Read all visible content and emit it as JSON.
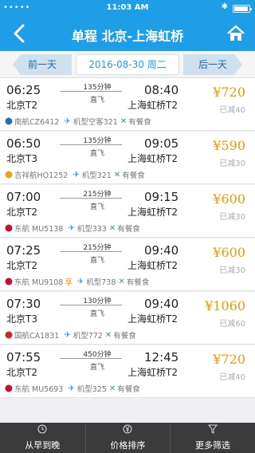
{
  "status": {
    "signal": "•••••",
    "time": "11:03 AM",
    "bluetooth": "✱",
    "battery_level": 0.95
  },
  "nav": {
    "title": "单程 北京-上海虹桥",
    "back_icon": "chevron-left-icon",
    "home_icon": "home-icon"
  },
  "datebar": {
    "prev_label": "前一天",
    "date": "2016-08-30 周二",
    "next_label": "后一天"
  },
  "flights": [
    {
      "dep_time": "06:25",
      "dep_airport": "北京T2",
      "duration": "135分钟",
      "type": "直飞",
      "arr_time": "08:40",
      "arr_airport": "上海虹桥T2",
      "price": "¥720",
      "discount": "已减40",
      "airline": "南航CZ6412",
      "aircraft": "机型空客321",
      "meal": "有餐食",
      "logo_color": "#2a6fb5"
    },
    {
      "dep_time": "06:50",
      "dep_airport": "北京T3",
      "duration": "135分钟",
      "type": "直飞",
      "arr_time": "09:05",
      "arr_airport": "上海虹桥T2",
      "price": "¥590",
      "discount": "已减30",
      "airline": "吉祥航HO1252",
      "aircraft": "机型321",
      "meal": "有餐食",
      "logo_color": "#e8a317"
    },
    {
      "dep_time": "07:00",
      "dep_airport": "北京T2",
      "duration": "215分钟",
      "type": "直飞",
      "arr_time": "09:15",
      "arr_airport": "上海虹桥T2",
      "price": "¥600",
      "discount": "已减30",
      "airline": "东航 MU5138",
      "aircraft": "机型333",
      "meal": "有餐食",
      "logo_color": "#c8102e"
    },
    {
      "dep_time": "07:25",
      "dep_airport": "北京T2",
      "duration": "215分钟",
      "type": "直飞",
      "arr_time": "09:40",
      "arr_airport": "上海虹桥T2",
      "price": "¥600",
      "discount": "已减30",
      "airline": "东航 MU9108",
      "share": "享",
      "aircraft": "机型738",
      "meal": "有餐食",
      "logo_color": "#c8102e"
    },
    {
      "dep_time": "07:30",
      "dep_airport": "北京T3",
      "duration": "130分钟",
      "type": "直飞",
      "arr_time": "09:40",
      "arr_airport": "上海虹桥T2",
      "price": "¥1060",
      "discount": "已减60",
      "airline": "国航CA1831",
      "aircraft": "机型772",
      "meal": "有餐食",
      "logo_color": "#d2232a"
    },
    {
      "dep_time": "07:55",
      "dep_airport": "北京T2",
      "duration": "450分钟",
      "type": "直飞",
      "arr_time": "12:45",
      "arr_airport": "上海虹桥T2",
      "price": "¥720",
      "discount": "已减40",
      "airline": "东航 MU5693",
      "aircraft": "机型325",
      "meal": "有餐食",
      "logo_color": "#c8102e"
    }
  ],
  "tabs": [
    {
      "label": "从早到晚",
      "icon": "clock-icon"
    },
    {
      "label": "价格排序",
      "icon": "yen-icon"
    },
    {
      "label": "更多筛选",
      "icon": "filter-icon"
    }
  ]
}
